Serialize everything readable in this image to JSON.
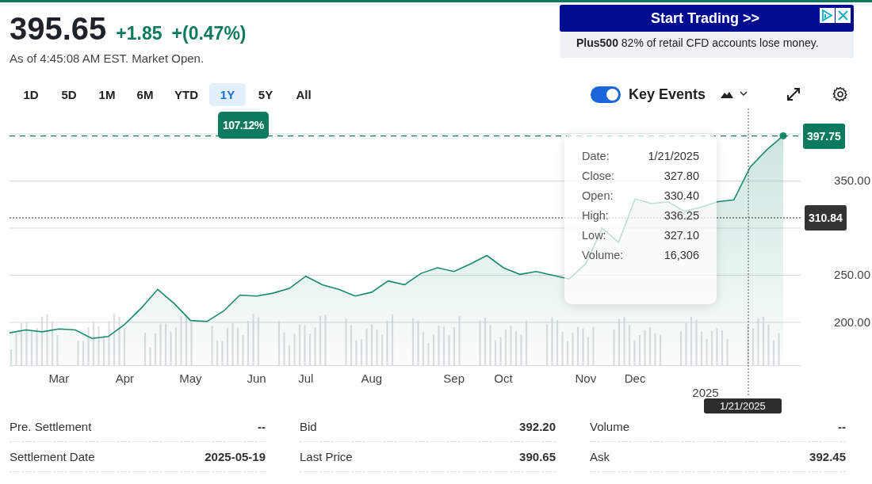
{
  "quote": {
    "price": "395.65",
    "change": "+1.85",
    "change_percent": "+(0.47%)",
    "as_of": "As of 4:45:08 AM EST. Market Open."
  },
  "ad": {
    "headline": "Start Trading >>",
    "text": "**Plus500** 82% of retail CFD accounts lose money."
  },
  "ranges": [
    {
      "label": "1D",
      "selected": false
    },
    {
      "label": "5D",
      "selected": false
    },
    {
      "label": "1M",
      "selected": false
    },
    {
      "label": "6M",
      "selected": false
    },
    {
      "label": "YTD",
      "selected": false
    },
    {
      "label": "1Y",
      "selected": true
    },
    {
      "label": "5Y",
      "selected": false
    },
    {
      "label": "All",
      "selected": false
    }
  ],
  "range_change": "107.12%",
  "key_events": {
    "label": "Key Events",
    "on": true
  },
  "chart": {
    "chart_data": {
      "type": "area",
      "grid": true,
      "ylim": [
        154,
        400
      ],
      "categories": [
        null,
        null,
        null,
        "Mar",
        null,
        null,
        null,
        "Apr",
        null,
        null,
        null,
        "May",
        null,
        null,
        null,
        "Jun",
        null,
        null,
        "Jul",
        null,
        null,
        null,
        "Aug",
        null,
        null,
        null,
        null,
        "Sep",
        null,
        null,
        "Oct",
        null,
        null,
        null,
        null,
        "Nov",
        null,
        null,
        "Dec",
        null,
        null,
        null,
        null,
        null,
        null,
        null,
        null,
        null
      ],
      "yticks": [
        {
          "value": 200,
          "label": "200.00"
        },
        {
          "value": 250,
          "label": "250.00"
        },
        {
          "value": 350,
          "label": "350.00"
        }
      ],
      "series": [
        {
          "color": "#1a8a6c",
          "values": [
            189,
            192,
            190,
            193,
            192,
            183,
            185,
            198,
            215,
            235,
            220,
            202,
            201,
            212,
            229,
            228,
            231,
            236,
            249,
            240,
            235,
            228,
            232,
            244,
            240,
            252,
            258,
            254,
            262,
            271,
            258,
            251,
            254,
            250,
            246,
            262,
            300,
            285,
            331,
            326,
            328,
            318,
            322,
            328,
            330,
            365,
            383,
            398
          ]
        }
      ]
    },
    "price_markers": [
      {
        "label": "397.75",
        "color": "#0b7a5e"
      },
      {
        "label": "310.84",
        "color": "#333333"
      }
    ],
    "year_label": "2025",
    "crosshair_date_label": "1/21/2025",
    "tooltip": [
      {
        "label": "Date:",
        "value": "1/21/2025"
      },
      {
        "label": "Close:",
        "value": "327.80"
      },
      {
        "label": "Open:",
        "value": "330.40"
      },
      {
        "label": "High:",
        "value": "336.25"
      },
      {
        "label": "Low:",
        "value": "327.10"
      },
      {
        "label": "Volume:",
        "value": "16,306"
      }
    ]
  },
  "stats": [
    [
      {
        "label": "Pre. Settlement",
        "value": "--"
      },
      {
        "label": "Settlement Date",
        "value": "2025-05-19"
      }
    ],
    [
      {
        "label": "Bid",
        "value": "392.20"
      },
      {
        "label": "Last Price",
        "value": "390.65"
      }
    ],
    [
      {
        "label": "Volume",
        "value": "--"
      },
      {
        "label": "Ask",
        "value": "392.45"
      }
    ]
  ]
}
